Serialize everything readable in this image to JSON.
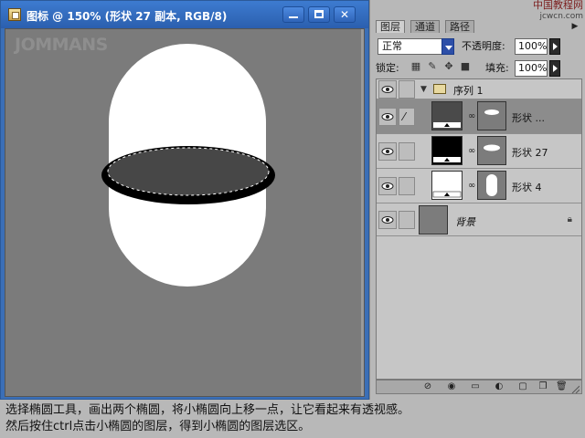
{
  "document": {
    "title": "图标 @ 150% (形状 27 副本, RGB/8)",
    "watermark": "JOMMANS"
  },
  "layers_panel": {
    "tabs": [
      {
        "label": "图层",
        "active": true
      },
      {
        "label": "通道",
        "active": false
      },
      {
        "label": "路径",
        "active": false
      }
    ],
    "site_mark": "中国教程网",
    "site_mark_sub": "jcwcn.com",
    "blend_mode": "正常",
    "opacity_label": "不透明度:",
    "opacity_value": "100%",
    "lock_label": "锁定:",
    "fill_label": "填充:",
    "fill_value": "100%",
    "layers": [
      {
        "name": "序列 1",
        "type": "group"
      },
      {
        "name": "形状 ...",
        "type": "shape",
        "selected": true
      },
      {
        "name": "形状 27",
        "type": "shape"
      },
      {
        "name": "形状 4",
        "type": "shape"
      },
      {
        "name": "背景",
        "type": "background",
        "locked": true
      }
    ]
  },
  "caption": {
    "line1": "选择椭圆工具，画出两个椭圆，将小椭圆向上移一点，让它看起来有透视感。",
    "line2": "然后按住ctrl点击小椭圆的图层，得到小椭圆的图层选区。"
  }
}
